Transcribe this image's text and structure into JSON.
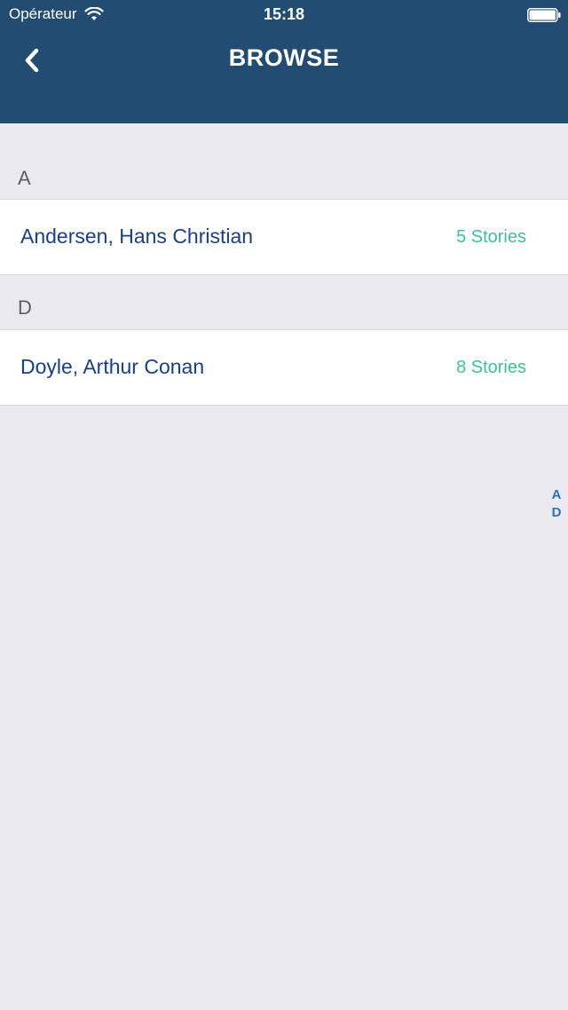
{
  "status_bar": {
    "carrier": "Opérateur",
    "time": "15:18"
  },
  "nav": {
    "title": "BROWSE",
    "back_icon": "chevron-left-icon"
  },
  "sections": [
    {
      "letter": "A",
      "rows": [
        {
          "name": "Andersen, Hans Christian",
          "count": "5 Stories"
        }
      ]
    },
    {
      "letter": "D",
      "rows": [
        {
          "name": "Doyle, Arthur Conan",
          "count": "8 Stories"
        }
      ]
    }
  ],
  "index": [
    "A",
    "D"
  ],
  "colors": {
    "header": "#224c72",
    "background": "#ebeaf0",
    "name": "#1b3f82",
    "count": "#40bf96",
    "index": "#2f71b3"
  }
}
